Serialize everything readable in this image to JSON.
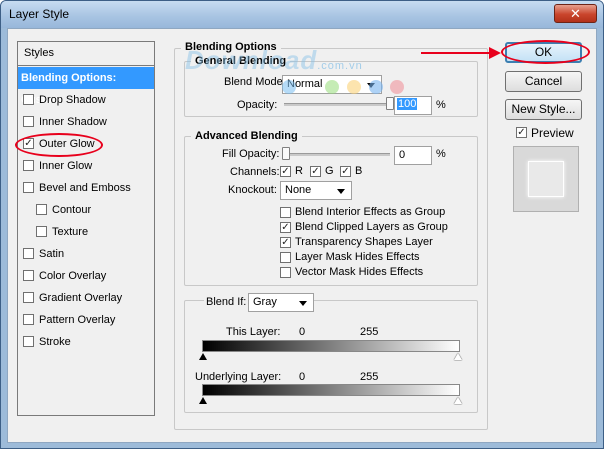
{
  "window": {
    "title": "Layer Style",
    "close_glyph": "✕"
  },
  "styles": {
    "header": "Styles",
    "items": [
      {
        "label": "Blending Options: Custom",
        "selected": true
      },
      {
        "label": "Drop Shadow",
        "checked": false
      },
      {
        "label": "Inner Shadow",
        "checked": false
      },
      {
        "label": "Outer Glow",
        "checked": true
      },
      {
        "label": "Inner Glow",
        "checked": false
      },
      {
        "label": "Bevel and Emboss",
        "checked": false
      },
      {
        "label": "Contour",
        "checked": false,
        "indent": true
      },
      {
        "label": "Texture",
        "checked": false,
        "indent": true
      },
      {
        "label": "Satin",
        "checked": false
      },
      {
        "label": "Color Overlay",
        "checked": false
      },
      {
        "label": "Gradient Overlay",
        "checked": false
      },
      {
        "label": "Pattern Overlay",
        "checked": false
      },
      {
        "label": "Stroke",
        "checked": false
      }
    ]
  },
  "blending": {
    "section_title": "Blending Options",
    "general_title": "General Blending",
    "blend_mode_label": "Blend Mode:",
    "blend_mode_value": "Normal",
    "opacity_label": "Opacity:",
    "opacity_value": "100",
    "opacity_unit": "%",
    "opacity_fraction": 1.0
  },
  "advanced": {
    "title": "Advanced Blending",
    "fill_opacity_label": "Fill Opacity:",
    "fill_opacity_value": "0",
    "fill_opacity_unit": "%",
    "fill_opacity_fraction": 0.0,
    "channels_label": "Channels:",
    "channels": [
      {
        "label": "R",
        "checked": true
      },
      {
        "label": "G",
        "checked": true
      },
      {
        "label": "B",
        "checked": true
      }
    ],
    "knockout_label": "Knockout:",
    "knockout_value": "None",
    "options": [
      {
        "label": "Blend Interior Effects as Group",
        "checked": false
      },
      {
        "label": "Blend Clipped Layers as Group",
        "checked": true
      },
      {
        "label": "Transparency Shapes Layer",
        "checked": true
      },
      {
        "label": "Layer Mask Hides Effects",
        "checked": false
      },
      {
        "label": "Vector Mask Hides Effects",
        "checked": false
      }
    ]
  },
  "blend_if": {
    "label": "Blend If:",
    "value": "Gray",
    "this_layer_label": "This Layer:",
    "this_layer_min": "0",
    "this_layer_max": "255",
    "underlying_label": "Underlying Layer:",
    "underlying_min": "0",
    "underlying_max": "255"
  },
  "buttons": {
    "ok": "OK",
    "cancel": "Cancel",
    "new_style": "New Style...",
    "preview_label": "Preview",
    "preview_checked": true
  },
  "watermark": {
    "text": "Download",
    "suffix": ".com.vn"
  },
  "colors": {
    "selection": "#3399ff",
    "annotation_red": "#e8001c",
    "titlebar": "#a9c5e3"
  }
}
